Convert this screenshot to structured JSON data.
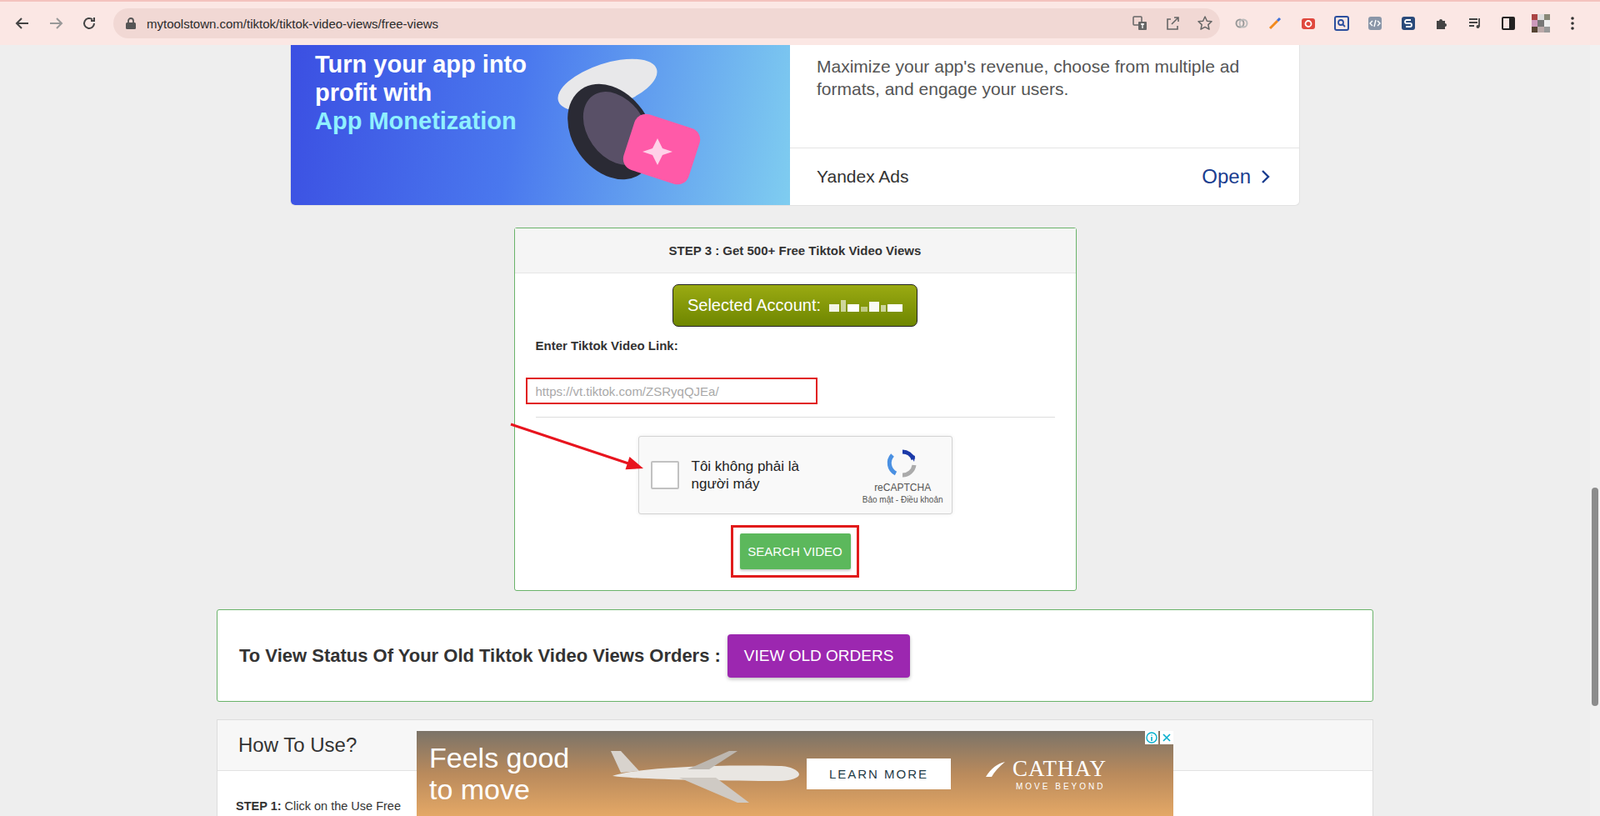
{
  "browser": {
    "url": "mytoolstown.com/tiktok/tiktok-video-views/free-views"
  },
  "top_ad": {
    "headline_lines": [
      "Turn your app into",
      "profit with"
    ],
    "highlight": "App Monetization",
    "description": "Maximize your app's revenue, choose from multiple ad formats, and engage your users.",
    "advertiser": "Yandex Ads",
    "cta": "Open"
  },
  "step_card": {
    "title": "STEP 3 : Get 500+ Free Tiktok Video Views",
    "account_label": "Selected Account:",
    "link_label": "Enter Tiktok Video Link:",
    "link_placeholder": "https://vt.tiktok.com/ZSRyqQJEa/",
    "captcha": {
      "label": "Tôi không phải là người máy",
      "checked": false,
      "brand": "reCAPTCHA",
      "links": "Bảo mật - Điều khoản"
    },
    "button": "SEARCH VIDEO"
  },
  "old_orders": {
    "text": "To View Status Of Your Old Tiktok Video Views Orders :",
    "button": "VIEW OLD ORDERS"
  },
  "how_to": {
    "title": "How To Use?",
    "step_label": "STEP 1:",
    "step_text": "Click on the Use Free"
  },
  "bottom_ad": {
    "headline_lines": [
      "Feels good",
      "to move"
    ],
    "cta": "LEARN MORE",
    "brand": "CATHAY",
    "tagline": "MOVE BEYOND"
  }
}
